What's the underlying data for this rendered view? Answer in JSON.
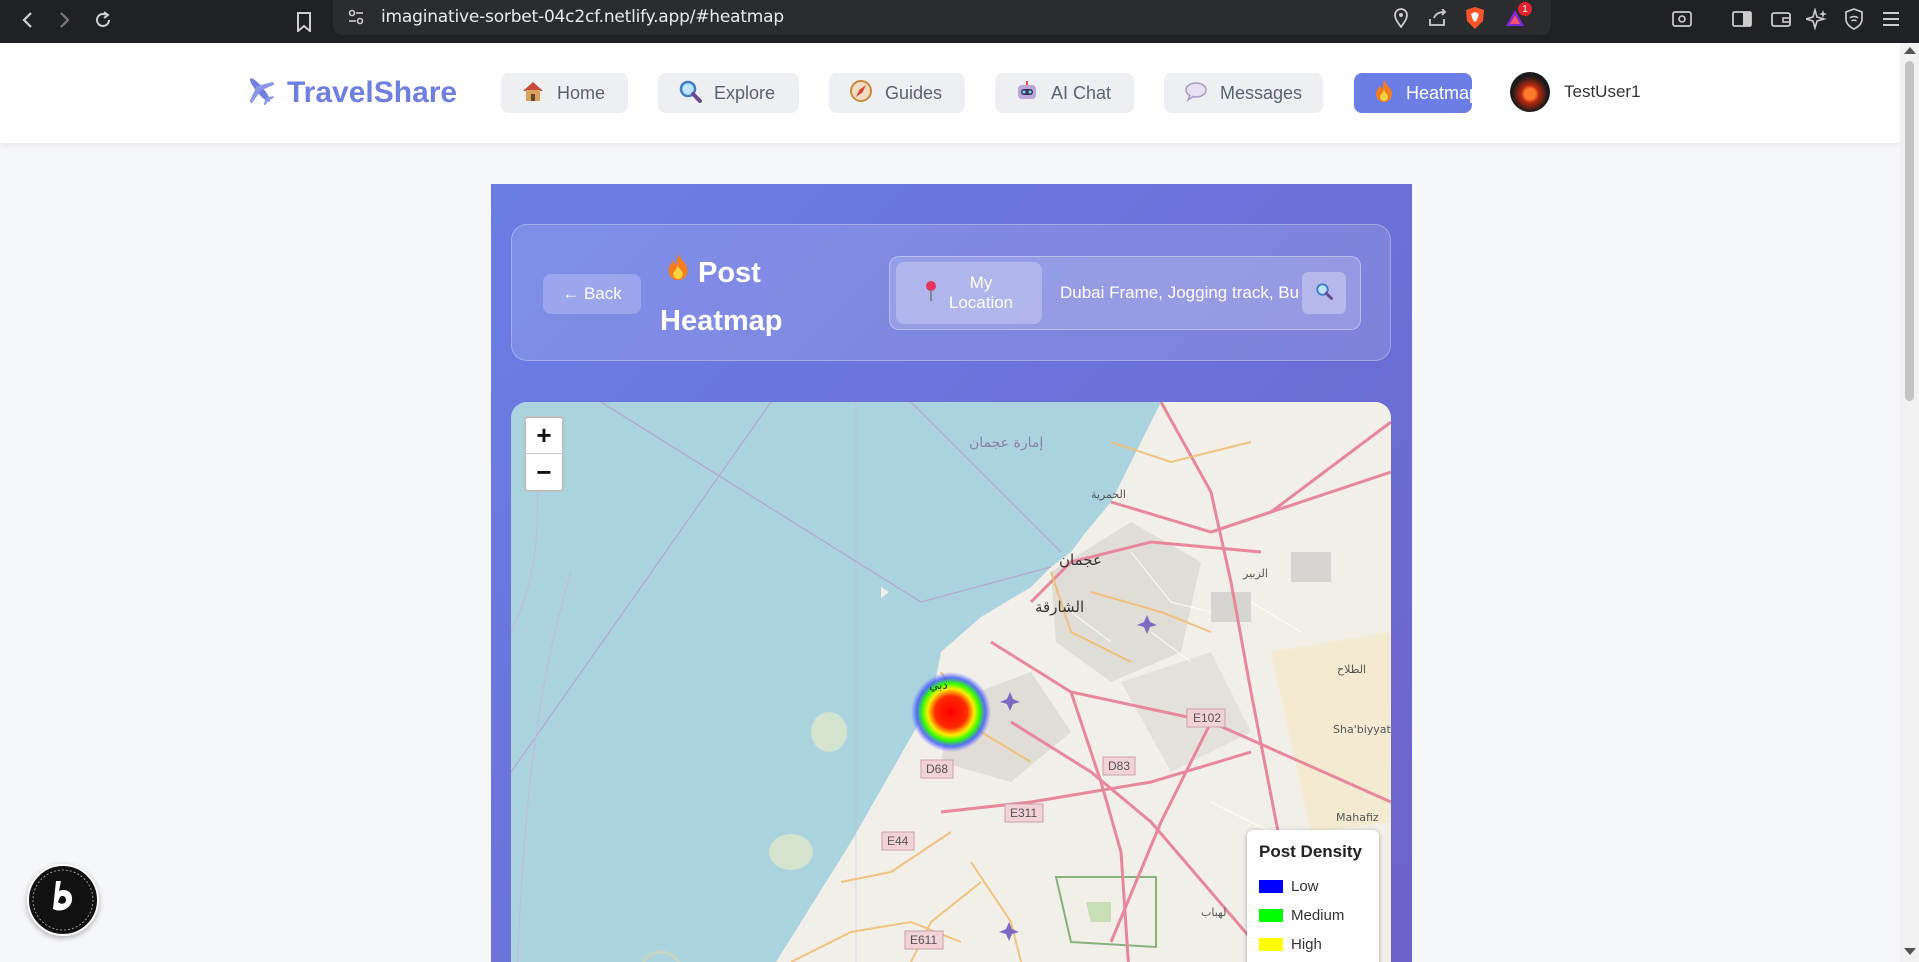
{
  "browser": {
    "url": "imaginative-sorbet-04c2cf.netlify.app/#heatmap",
    "notification_count": "1"
  },
  "header": {
    "brand": "TravelShare",
    "nav": [
      {
        "label": "Home",
        "icon": "house-icon"
      },
      {
        "label": "Explore",
        "icon": "search-icon"
      },
      {
        "label": "Guides",
        "icon": "compass-icon"
      },
      {
        "label": "AI Chat",
        "icon": "robot-icon"
      },
      {
        "label": "Messages",
        "icon": "speech-bubble-icon"
      },
      {
        "label": "Heatmap",
        "icon": "fire-icon",
        "active": true
      }
    ],
    "user": "TestUser1"
  },
  "heatmap_page": {
    "back_label": "← Back",
    "title": "Post Heatmap",
    "my_location_label": "My Location",
    "search_value": "Dubai Frame, Jogging track, Bur Dubai"
  },
  "map": {
    "labels": {
      "ajman_emirate": "إمارة عجمان",
      "ajman": "عجمان",
      "sharjah": "الشارقة",
      "hamriyah": "الحمرية",
      "zubair": "الزبير",
      "tallah": "الطلاح",
      "rashidiyyah": "Sha'biyyat as Rashidiyyah",
      "mahafiz": "Mahafiz",
      "lahbab": "لهباب",
      "dubai": "دبي"
    },
    "road_labels": [
      "E102",
      "D83",
      "D68",
      "E311",
      "E44",
      "E611"
    ],
    "zoom_in": "+",
    "zoom_out": "−"
  },
  "legend": {
    "title": "Post Density",
    "items": [
      {
        "label": "Low",
        "color": "#0000ff"
      },
      {
        "label": "Medium",
        "color": "#00ff00"
      },
      {
        "label": "High",
        "color": "#ffff00"
      }
    ]
  },
  "colors": {
    "accent": "#6b7ee6",
    "panel_end": "#6c63c9"
  }
}
